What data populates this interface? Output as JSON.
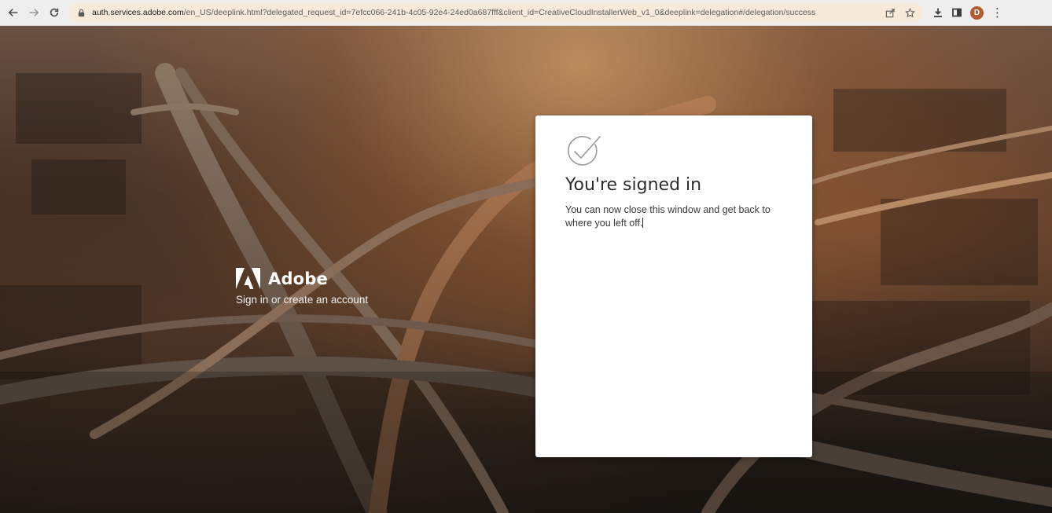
{
  "browser": {
    "url_domain": "auth.services.adobe.com",
    "url_path": "/en_US/deeplink.html?delegated_request_id=7efcc066-241b-4c05-92e4-24ed0a687fff&client_id=CreativeCloudInstallerWeb_v1_0&deeplink=delegation#/delegation/success",
    "profile_initial": "D",
    "profile_color": "#b55a2e",
    "omnibox_color": "#f7ead9"
  },
  "brand": {
    "name": "Adobe",
    "tagline": "Sign in or create an account",
    "logo_icon": "adobe-logo"
  },
  "card": {
    "icon": "checkmark-circle-icon",
    "title": "You're signed in",
    "body": "You can now close this window and get back to where you left off."
  }
}
